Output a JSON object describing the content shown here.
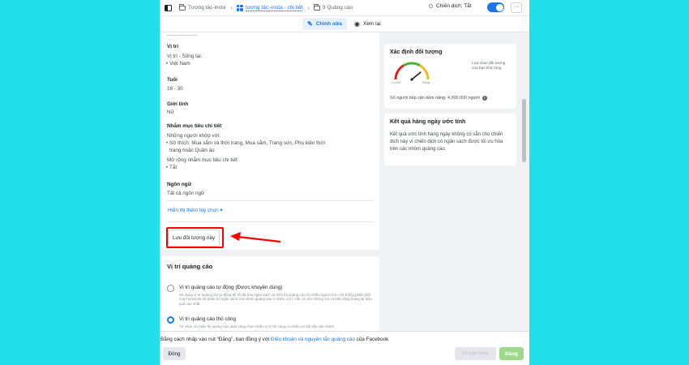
{
  "header": {
    "breadcrumbs": [
      "Tương tác-insta",
      "tương tác -insta - chi tiết",
      "9 Quảng cáo"
    ],
    "status_label": "Chiến dịch: Tắt",
    "more_label": "···"
  },
  "mode_tabs": {
    "edit": "Chỉnh sửa",
    "view": "Xem lại"
  },
  "targeting": {
    "location_label": "Vị trí",
    "location_text": "Vị trí - Sống tại:",
    "location_value": "Việt Nam",
    "age_label": "Tuổi",
    "age_value": "18 - 30",
    "gender_label": "Giới tính",
    "gender_value": "Nữ",
    "detailed_label": "Nhắm mục tiêu chi tiết",
    "detailed_match": "Những người khớp với:",
    "interests_line1": "Sở thích: Mua sắm và thời trang, Mua sắm, Trang sức, Phụ kiện thời",
    "interests_line2": "trang hoặc Quần áo",
    "expand_label": "Mở rộng nhắm mục tiêu chi tiết:",
    "expand_value": "Tắt",
    "language_label": "Ngôn ngữ",
    "language_value": "Tất cả ngôn ngữ",
    "show_more": "Hiển thị thêm tùy chọn ▾",
    "save_audience": "Lưu đối tượng này"
  },
  "placements": {
    "title": "Vị trí quảng cáo",
    "auto_title": "Vị trí quảng cáo tự động (Được khuyên dùng)",
    "auto_desc": "Sử dụng vị trí quảng cáo tự động để tối đa hóa ngân sách và hiển thị quảng cáo tới nhiều người hơn. Hệ thống phân phối của Facebook sẽ phân bổ ngân sách của nhóm quảng cáo ở nhiều vị trí, căn cứ vào những nơi có khả năng mang lại hiệu quả cao nhất.",
    "manual_title": "Vị trí quảng cáo thủ công",
    "manual_desc": "Tự chọn nơi hiển thị quảng cáo. Bạn càng chọn nhiều vị trí thì càng có nhiều cơ hội tiếp cận nhóm"
  },
  "audience_definition": {
    "title": "Xác định đối tượng",
    "gauge_left": "Cụ thể",
    "gauge_right": "Rộng",
    "note": "Lựa chọn đối tượng của bạn khá rộng.",
    "reach_text": "Số người tiếp cận tiềm năng: 4.000.000 người",
    "gauge_level": 0.78
  },
  "daily_results": {
    "title": "Kết quả hàng ngày ước tính",
    "body": "Kết quả ước tính hàng ngày không có sẵn cho chiến dịch này vì chiến dịch có ngân sách được tối ưu hóa trên các nhóm quảng cáo."
  },
  "footer": {
    "consent_prefix": "Bằng cách nhấp vào nút \"Đăng\", bạn đồng ý với ",
    "consent_link": "Điều khoản và nguyên tắc quảng cáo",
    "consent_suffix": " của Facebook",
    "close": "Đóng",
    "draft": "Bỏ bản nháp",
    "publish": "Đăng"
  },
  "colors": {
    "background": "#22e0ea",
    "accent": "#1877f2",
    "highlight": "#ff0000",
    "publish": "#9fd88b"
  }
}
